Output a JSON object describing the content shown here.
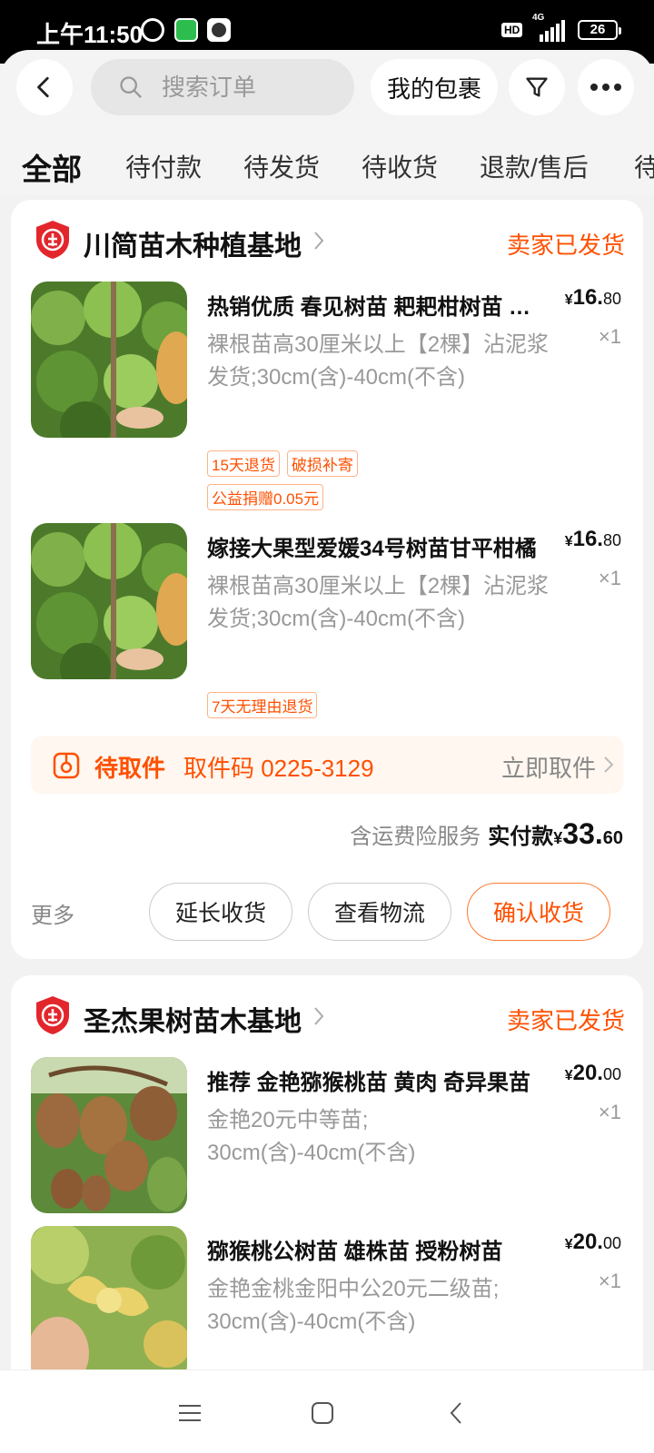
{
  "status_bar": {
    "time": "上午11:50",
    "hd": "HD",
    "network": "4G",
    "battery": "26"
  },
  "header": {
    "search_placeholder": "搜索订单",
    "package_label": "我的包裹",
    "tabs": [
      "全部",
      "待付款",
      "待发货",
      "待收货",
      "退款/售后",
      "待"
    ]
  },
  "orders": [
    {
      "shop_name": "川简苗木种植基地",
      "status": "卖家已发货",
      "items": [
        {
          "title": "热销优质 春见树苗 耙耙柑树苗 嫁接",
          "spec": "裸根苗高30厘米以上【2棵】沾泥浆发货;30cm(含)-40cm(不含)",
          "price_currency": "¥",
          "price_int": "16.",
          "price_dec": "80",
          "qty": "×1",
          "tags": [
            "15天退货",
            "破损补寄",
            "公益捐赠0.05元"
          ]
        },
        {
          "title": "嫁接大果型爱媛34号树苗甘平柑橘",
          "spec": "裸根苗高30厘米以上【2棵】沾泥浆发货;30cm(含)-40cm(不含)",
          "price_currency": "¥",
          "price_int": "16.",
          "price_dec": "80",
          "qty": "×1",
          "tags": [
            "7天无理由退货"
          ]
        }
      ],
      "pickup": {
        "status": "待取件",
        "code": "取件码 0225-3129",
        "action": "立即取件"
      },
      "total": {
        "service": "含运费险服务",
        "label": "实付款",
        "currency": "¥",
        "int": "33.",
        "dec": "60"
      },
      "actions": {
        "more": "更多",
        "extend": "延长收货",
        "logistics": "查看物流",
        "confirm": "确认收货"
      }
    },
    {
      "shop_name": "圣杰果树苗木基地",
      "status": "卖家已发货",
      "items": [
        {
          "title": "推荐 金艳猕猴桃苗  黄肉 奇异果苗",
          "spec": "金艳20元中等苗;\n30cm(含)-40cm(不含)",
          "price_currency": "¥",
          "price_int": "20.",
          "price_dec": "00",
          "qty": "×1"
        },
        {
          "title": "猕猴桃公树苗 雄株苗 授粉树苗",
          "spec": "金艳金桃金阳中公20元二级苗;\n30cm(含)-40cm(不含)",
          "price_currency": "¥",
          "price_int": "20.",
          "price_dec": "00",
          "qty": "×1"
        }
      ]
    }
  ],
  "icons": {
    "back": "back-icon",
    "search": "search-icon",
    "filter": "filter-icon",
    "more": "more-icon",
    "shop_logo": "shop-badge-icon",
    "pickup": "package-pickup-icon",
    "nav": [
      "menu-icon",
      "home-icon",
      "back-nav-icon"
    ]
  },
  "colors": {
    "accent": "#ff5000",
    "tag_border": "#ffb38a",
    "page_bg": "#f2f2f2"
  }
}
